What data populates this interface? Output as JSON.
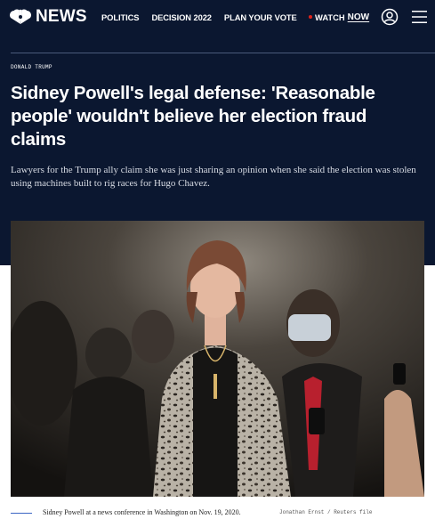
{
  "header": {
    "logo_text": "NEWS",
    "nav": [
      "POLITICS",
      "DECISION 2022",
      "PLAN YOUR VOTE"
    ],
    "watch_label": "WATCH",
    "watch_now_label": "NOW",
    "icons": {
      "account": "account-icon",
      "menu": "hamburger-menu-icon",
      "logo": "peacock-logo-icon"
    }
  },
  "article": {
    "eyebrow": "DONALD TRUMP",
    "headline": "Sidney Powell's legal defense: 'Reasonable people' wouldn't believe her election fraud claims",
    "dek": "Lawyers for the Trump ally claim she was just sharing an opinion when she said the election was stolen using machines built to rig races for Hugo Chavez.",
    "image": {
      "caption": "Sidney Powell at a news conference in Washington on Nov. 19, 2020.",
      "credit": "Jonathan Ernst / Reuters file"
    }
  },
  "colors": {
    "navy": "#0b1730",
    "live_red": "#e2231a",
    "caption_rule": "#3b66c4"
  }
}
